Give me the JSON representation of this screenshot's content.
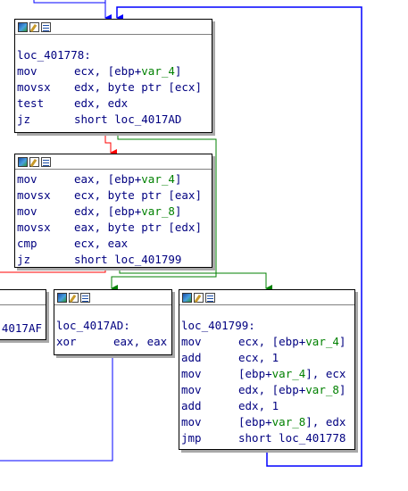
{
  "blocks": {
    "b1": {
      "label": "loc_401778:",
      "lines": [
        {
          "mn": "mov",
          "pre": "ecx, [ebp+",
          "var": "var_4",
          "post": "]"
        },
        {
          "mn": "movsx",
          "pre": "edx, byte ptr [ecx]",
          "var": "",
          "post": ""
        },
        {
          "mn": "test",
          "pre": "edx, edx",
          "var": "",
          "post": ""
        },
        {
          "mn": "jz",
          "pre": "short loc_4017AD",
          "var": "",
          "post": ""
        }
      ]
    },
    "b2": {
      "lines": [
        {
          "mn": "mov",
          "pre": "eax, [ebp+",
          "var": "var_4",
          "post": "]"
        },
        {
          "mn": "movsx",
          "pre": "ecx, byte ptr [eax]",
          "var": "",
          "post": ""
        },
        {
          "mn": "mov",
          "pre": "edx, [ebp+",
          "var": "var_8",
          "post": "]"
        },
        {
          "mn": "movsx",
          "pre": "eax, byte ptr [edx]",
          "var": "",
          "post": ""
        },
        {
          "mn": "cmp",
          "pre": "ecx, eax",
          "var": "",
          "post": ""
        },
        {
          "mn": "jz",
          "pre": "short loc_401799",
          "var": "",
          "post": ""
        }
      ]
    },
    "b3": {
      "fragment": "4017AF"
    },
    "b4": {
      "label": "loc_4017AD:",
      "lines": [
        {
          "mn": "xor",
          "pre": "eax, eax",
          "var": "",
          "post": ""
        }
      ]
    },
    "b5": {
      "label": "loc_401799:",
      "lines": [
        {
          "mn": "mov",
          "pre": "ecx, [ebp+",
          "var": "var_4",
          "post": "]"
        },
        {
          "mn": "add",
          "pre": "ecx, 1",
          "var": "",
          "post": ""
        },
        {
          "mn": "mov",
          "pre": "[ebp+",
          "var": "var_4",
          "post": "], ecx"
        },
        {
          "mn": "mov",
          "pre": "edx, [ebp+",
          "var": "var_8",
          "post": "]"
        },
        {
          "mn": "add",
          "pre": "edx, 1",
          "var": "",
          "post": ""
        },
        {
          "mn": "mov",
          "pre": "[ebp+",
          "var": "var_8",
          "post": "], edx"
        },
        {
          "mn": "jmp",
          "pre": "short loc_401778",
          "var": "",
          "post": ""
        }
      ]
    }
  },
  "edge_colors": {
    "unconditional": "#0000ff",
    "true_branch": "#008000",
    "false_branch": "#ff0000"
  }
}
